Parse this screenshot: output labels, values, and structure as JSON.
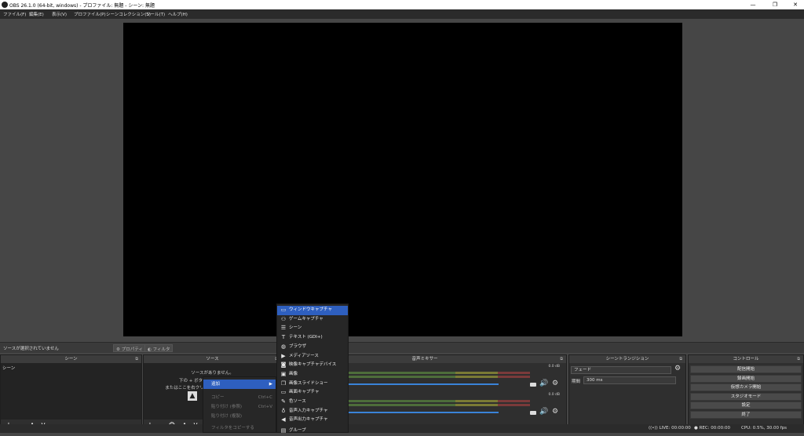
{
  "window": {
    "title": "OBS 26.1.0 (64-bit, windows) - プロファイル: 無題 - シーン: 無題",
    "minimize": "—",
    "maximize": "❐",
    "close": "✕"
  },
  "menu": [
    {
      "label": "ファイル(F)"
    },
    {
      "label": "編集(E)"
    },
    {
      "label": "表示(V)"
    },
    {
      "label": "プロファイル(P)"
    },
    {
      "label": "シーンコレクション(S)"
    },
    {
      "label": "ツール(T)"
    },
    {
      "label": "ヘルプ(H)"
    }
  ],
  "propbar": {
    "no_source": "ソースが選択されていません",
    "properties": "プロパティ",
    "filters": "フィルタ"
  },
  "docks": {
    "scenes": {
      "title": "シーン",
      "item": "シーン"
    },
    "sources": {
      "title": "ソース",
      "empty1": "ソースがありません。",
      "empty2": "下の + ボタンをクリックするか、",
      "empty3": "またはここを右クリックして追加してください。"
    },
    "mixer": {
      "title": "音声ミキサー",
      "db1": "0.0 dB",
      "db2": "0.0 dB"
    },
    "transitions": {
      "title": "シーントランジション",
      "type": "フェード",
      "duration_label": "期間",
      "duration": "300 ms"
    },
    "controls": {
      "title": "コントロール",
      "buttons": [
        "配信開始",
        "録画開始",
        "仮想カメラ開始",
        "スタジオモード",
        "設定",
        "終了"
      ]
    }
  },
  "context_menu": [
    {
      "label": "追加",
      "shortcut": "▶",
      "active": true
    },
    {
      "label": "コピー",
      "shortcut": "Ctrl+C"
    },
    {
      "label": "貼り付け (参照)",
      "shortcut": "Ctrl+V"
    },
    {
      "label": "貼り付け (複製)",
      "shortcut": ""
    },
    {
      "label": "フィルタをコピーする",
      "shortcut": ""
    }
  ],
  "submenu": [
    {
      "label": "ウィンドウキャプチャ",
      "icon": "window-icon",
      "glyph": "▭"
    },
    {
      "label": "ゲームキャプチャ",
      "icon": "gamepad-icon",
      "glyph": "⚇"
    },
    {
      "label": "シーン",
      "icon": "list-icon",
      "glyph": "☰"
    },
    {
      "label": "テキスト (GDI+)",
      "icon": "text-icon",
      "glyph": "T"
    },
    {
      "label": "ブラウザ",
      "icon": "globe-icon",
      "glyph": "◍"
    },
    {
      "label": "メディアソース",
      "icon": "play-icon",
      "glyph": "▶"
    },
    {
      "label": "映像キャプチャデバイス",
      "icon": "camera-icon",
      "glyph": "◙"
    },
    {
      "label": "画像",
      "icon": "image-icon",
      "glyph": "▣"
    },
    {
      "label": "画像スライドショー",
      "icon": "slideshow-icon",
      "glyph": "❐"
    },
    {
      "label": "画面キャプチャ",
      "icon": "monitor-icon",
      "glyph": "▭"
    },
    {
      "label": "色ソース",
      "icon": "brush-icon",
      "glyph": "✎"
    },
    {
      "label": "音声入力キャプチャ",
      "icon": "microphone-icon",
      "glyph": "♁"
    },
    {
      "label": "音声出力キャプチャ",
      "icon": "speaker-icon",
      "glyph": "◀"
    },
    {
      "label": "グループ",
      "icon": "group-icon",
      "glyph": "▤"
    }
  ],
  "status": {
    "live": "LIVE: 00:00:00",
    "rec": "REC: 00:00:00",
    "cpu": "CPU: 0.5%, 30.00 fps"
  },
  "toolbar": {
    "add": "+",
    "remove": "−",
    "up": "∧",
    "down": "∨",
    "gear": "⚙"
  }
}
